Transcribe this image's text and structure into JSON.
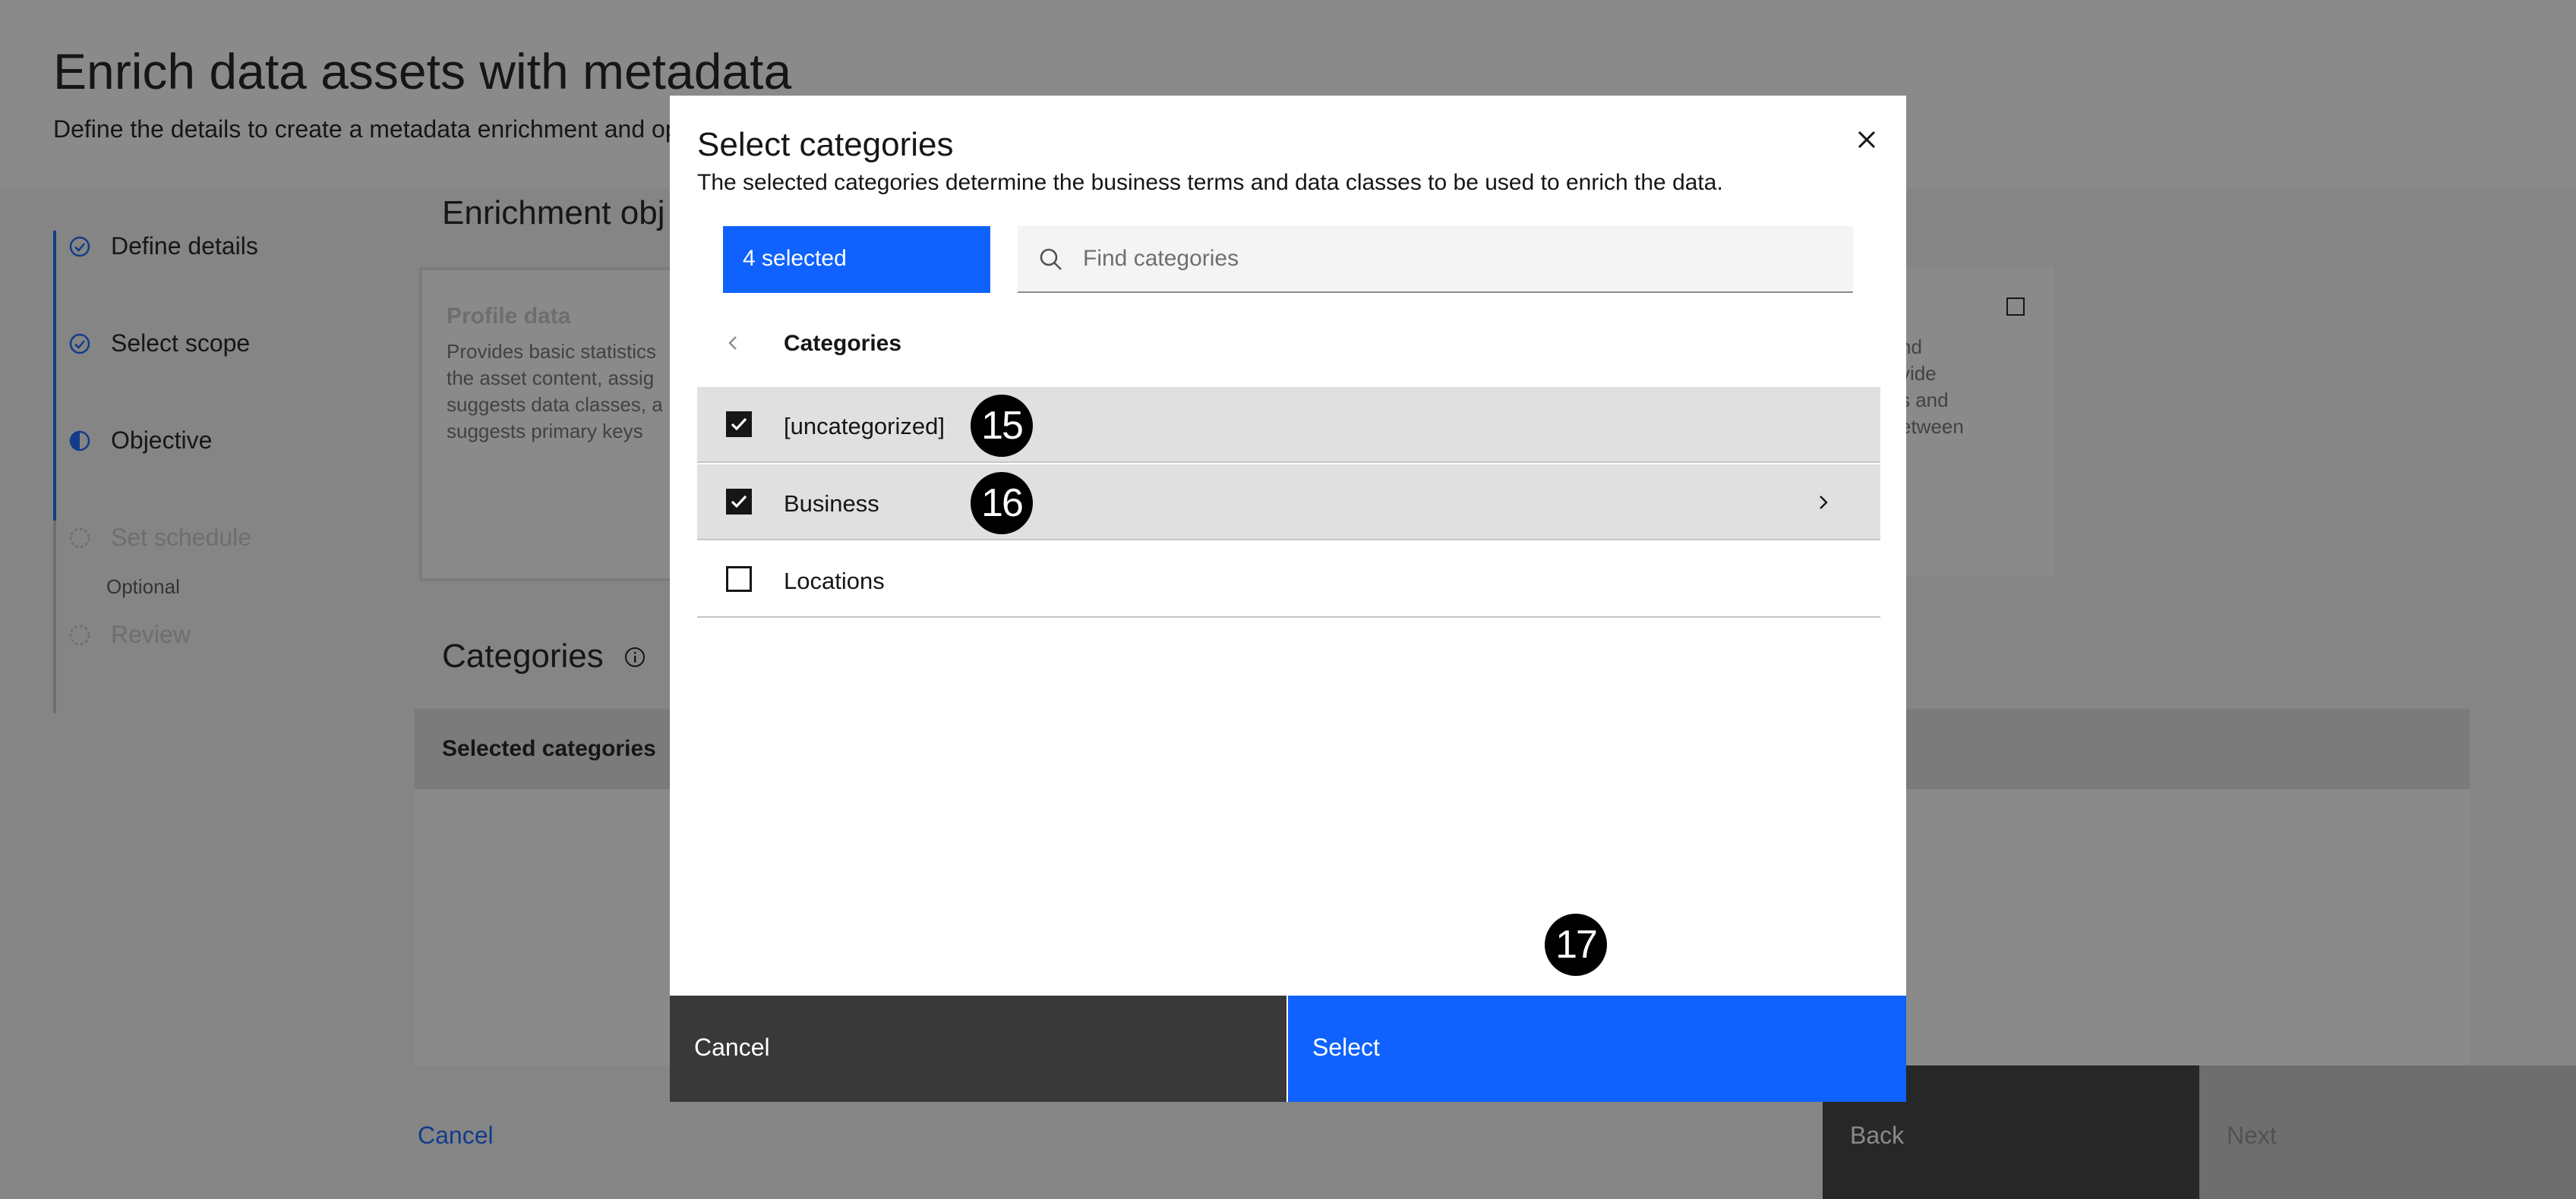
{
  "page": {
    "title": "Enrich data assets with metadata",
    "description": "Define the details to create a metadata enrichment and op"
  },
  "steps": [
    {
      "label": "Define details",
      "state": "complete"
    },
    {
      "label": "Select scope",
      "state": "complete"
    },
    {
      "label": "Objective",
      "state": "current"
    },
    {
      "label": "Set schedule",
      "state": "disabled",
      "sub": "Optional"
    },
    {
      "label": "Review",
      "state": "disabled"
    }
  ],
  "main": {
    "objective_title": "Enrichment obj",
    "profile_tile": {
      "title": "Profile data",
      "lines": [
        "Provides basic statistics",
        "the asset content, assig",
        "suggests data classes, a",
        "suggests primary keys"
      ]
    },
    "second_tile": {
      "lines": [
        "nd",
        "vide",
        "s and",
        "etween"
      ]
    },
    "categories_title": "Categories",
    "selected_categories_header": "Selected categories",
    "cancel_link": "Cancel",
    "back_button": "Back",
    "next_button": "Next"
  },
  "modal": {
    "title": "Select categories",
    "description": "The selected categories determine the business terms and data classes to be used to enrich the data.",
    "selected_tag": "4 selected",
    "search": {
      "placeholder": "Find categories",
      "value": ""
    },
    "breadcrumb": "Categories",
    "items": [
      {
        "label": "[uncategorized]",
        "checked": true,
        "badge": "15"
      },
      {
        "label": "Business",
        "checked": true,
        "badge": "16",
        "has_children": true
      },
      {
        "label": "Locations",
        "checked": false
      }
    ],
    "select_badge": "17",
    "cancel_button": "Cancel",
    "select_button": "Select"
  },
  "colors": {
    "primary": "#0f62fe",
    "dark_button": "#393939",
    "selected_row": "#e0e0e0"
  }
}
